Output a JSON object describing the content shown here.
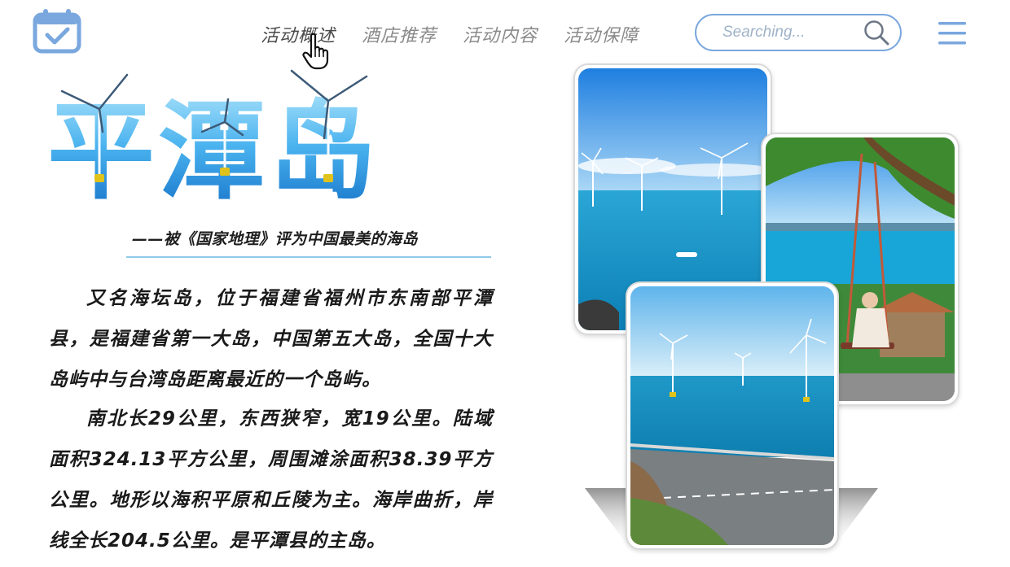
{
  "header": {
    "nav": [
      {
        "label": "活动概述",
        "active": true
      },
      {
        "label": "酒店推荐",
        "active": false
      },
      {
        "label": "活动内容",
        "active": false
      },
      {
        "label": "活动保障",
        "active": false
      }
    ],
    "search": {
      "placeholder": "Searching..."
    }
  },
  "hero": {
    "title": "平潭岛",
    "subtitle": "——被《国家地理》评为中国最美的海岛"
  },
  "intro": {
    "paragraph_1": "又名海坛岛，位于福建省福州市东南部平潭县，是福建省第一大岛，中国第五大岛，全国十大岛屿中与台湾岛距离最近的一个岛屿。",
    "paragraph_2": "南北长29公里，东西狭窄，宽19公里。陆域面积324.13平方公里，周围滩涂面积38.39平方公里。地形以海积平原和丘陵为主。海岸曲折，岸线全长204.5公里。是平潭县的主岛。"
  },
  "icons": {
    "logo": "calendar-check-icon",
    "search": "search-icon",
    "menu": "hamburger-menu-icon",
    "cursor": "hand-pointer-icon"
  },
  "colors": {
    "accent": "#7aa7de",
    "title_gradient_top": "#8fd6f5",
    "title_gradient_bottom": "#1b84d6",
    "divider": "#8ec9e9"
  }
}
